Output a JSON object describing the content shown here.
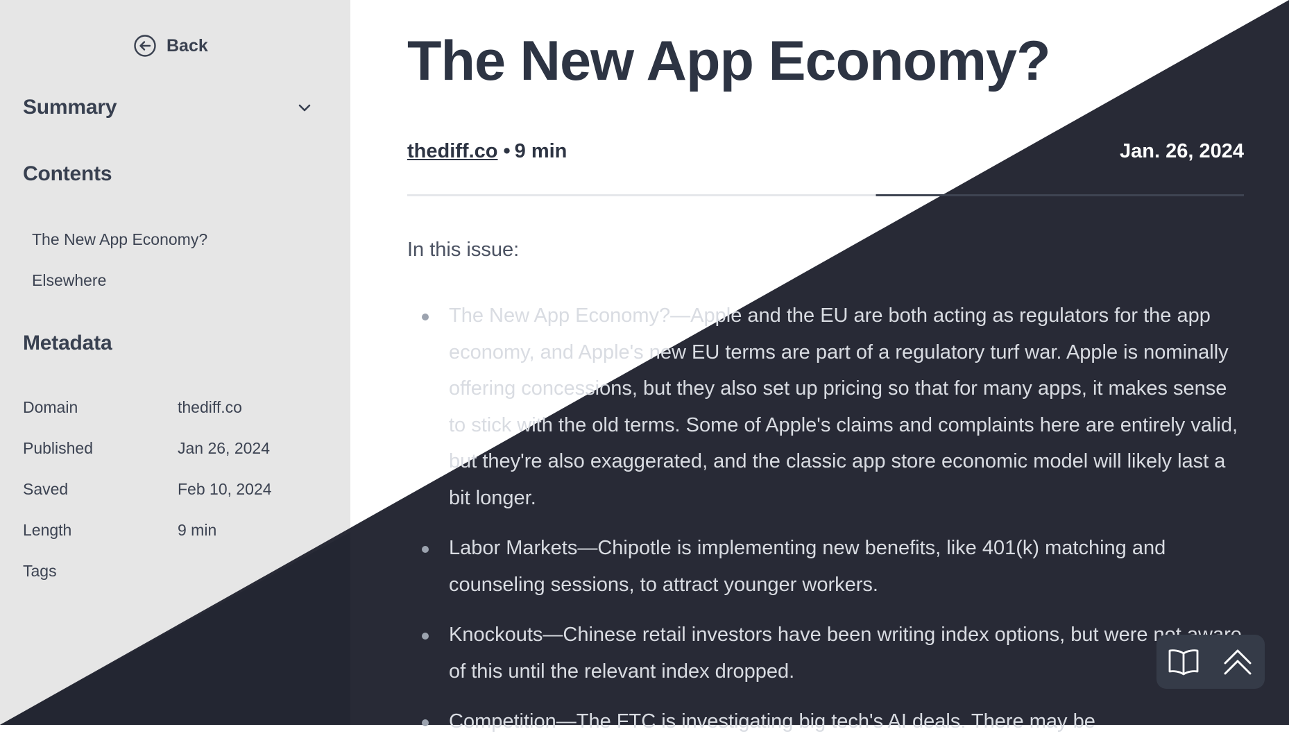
{
  "colors": {
    "sidebar_bg": "#e6e6e6",
    "dark_bg": "#282a36",
    "sidebar_dark_bg": "#232632",
    "text_dark": "#2d3443",
    "text_light": "#d9dce2"
  },
  "sidebar": {
    "back_label": "Back",
    "summary_label": "Summary",
    "contents_label": "Contents",
    "toc": [
      "The New App Economy?",
      "Elsewhere"
    ],
    "metadata_label": "Metadata",
    "metadata": [
      {
        "key": "Domain",
        "value": "thediff.co"
      },
      {
        "key": "Published",
        "value": "Jan 26, 2024"
      },
      {
        "key": "Saved",
        "value": "Feb 10, 2024"
      },
      {
        "key": "Length",
        "value": "9 min"
      },
      {
        "key": "Tags",
        "value": ""
      }
    ]
  },
  "article": {
    "title": "The New App Economy?",
    "domain": "thediff.co",
    "read_time": "9 min",
    "date": "Jan. 26, 2024",
    "intro": "In this issue:",
    "bullets": [
      "The New App Economy?—Apple and the EU are both acting as regulators for the app economy, and Apple's new EU terms are part of a regulatory turf war. Apple is nominally offering concessions, but they also set up pricing so that for many apps, it makes sense to stick with the old terms. Some of Apple's claims and complaints here are entirely valid, but they're also exaggerated, and the classic app store economic model will likely last a bit longer.",
      "Labor Markets—Chipotle is implementing new benefits, like 401(k) matching and counseling sessions, to attract younger workers.",
      "Knockouts—Chinese retail investors have been writing index options, but were not aware of this until the relevant index dropped.",
      "Competition—The FTC is investigating big tech's AI deals. There may be"
    ]
  },
  "fab": {
    "reader_icon": "open-book-icon",
    "top_icon": "double-chevron-up-icon"
  }
}
